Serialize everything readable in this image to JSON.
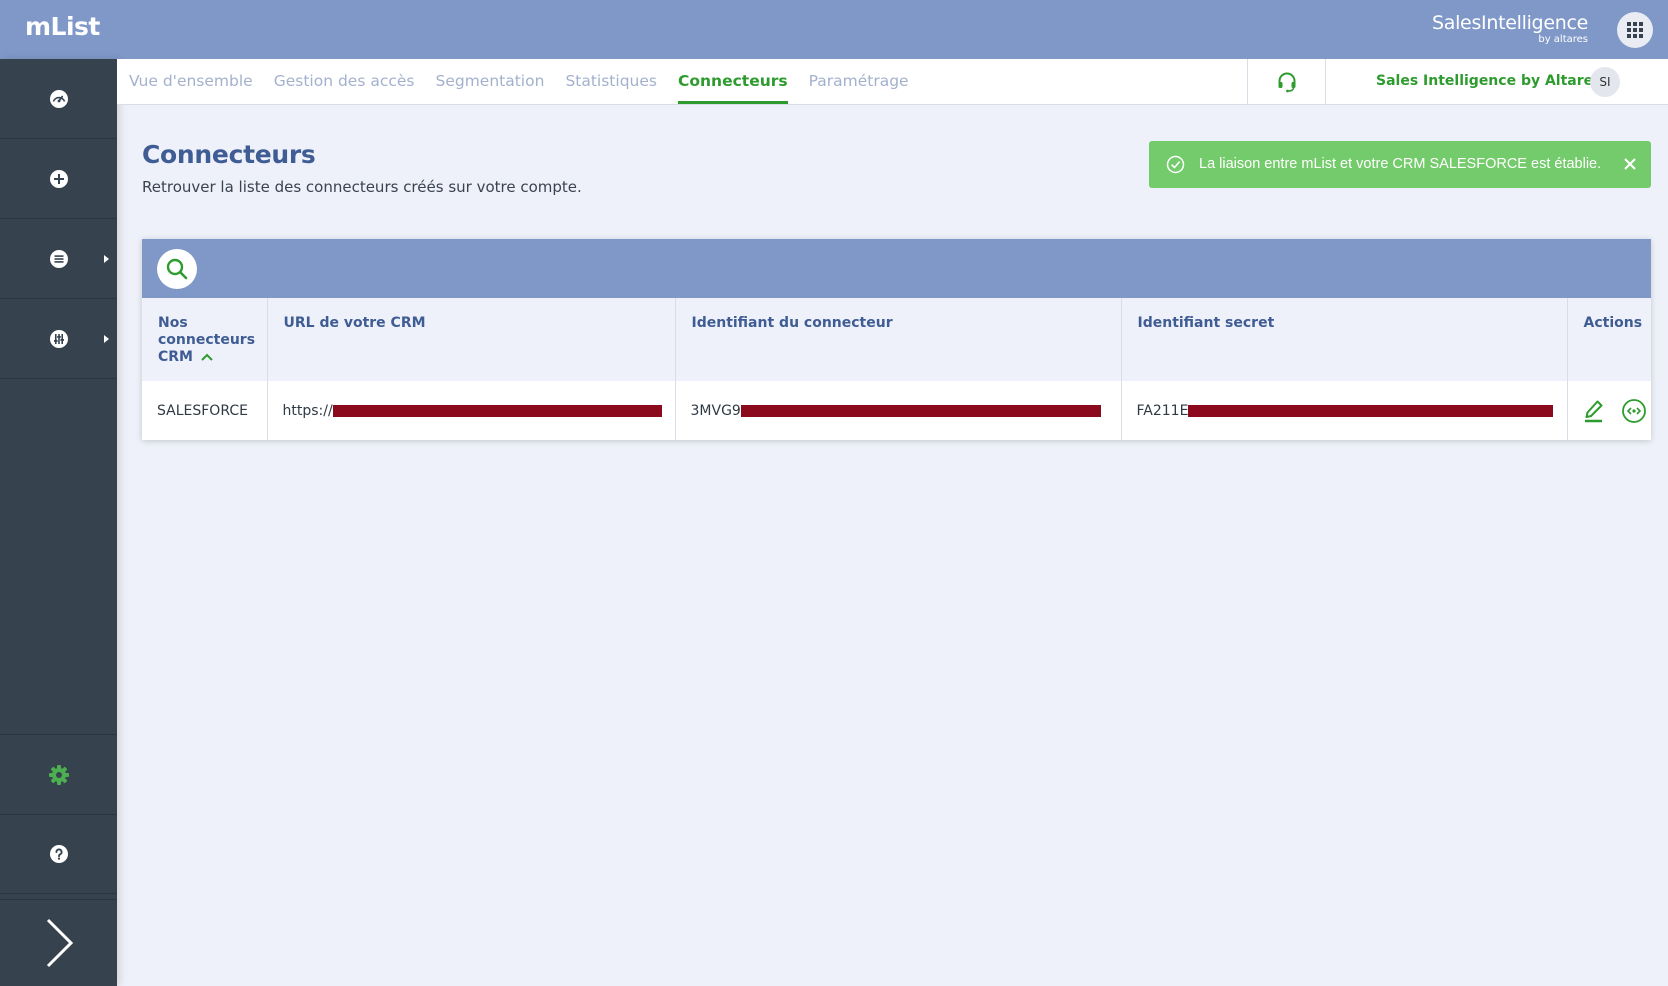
{
  "app": {
    "title": "mList"
  },
  "brand": {
    "name": "SalesIntelligence",
    "sub": "by altares"
  },
  "nav": {
    "tabs": [
      {
        "label": "Vue d'ensemble"
      },
      {
        "label": "Gestion des accès"
      },
      {
        "label": "Segmentation"
      },
      {
        "label": "Statistiques"
      },
      {
        "label": "Connecteurs",
        "active": true
      },
      {
        "label": "Paramétrage"
      }
    ],
    "account_name": "Sales Intelligence by Altares",
    "avatar_initials": "SI"
  },
  "sidebar": {
    "items": [
      {
        "icon": "dashboard-icon"
      },
      {
        "icon": "plus-circle-icon"
      },
      {
        "icon": "list-icon",
        "has_submenu": true
      },
      {
        "icon": "sliders-icon",
        "has_submenu": true
      },
      {
        "icon": "gear-icon",
        "active": true
      },
      {
        "icon": "help-icon"
      },
      {
        "icon": "chevron-right-icon"
      }
    ]
  },
  "page": {
    "title": "Connecteurs",
    "subtitle": "Retrouver la liste des connecteurs créés sur votre compte."
  },
  "toast": {
    "message": "La liaison entre mList et votre CRM SALESFORCE est établie.",
    "type": "success"
  },
  "table": {
    "columns": [
      {
        "label": "Nos connecteurs CRM",
        "sorted": "asc"
      },
      {
        "label": "URL de votre CRM"
      },
      {
        "label": "Identifiant du connecteur"
      },
      {
        "label": "Identifiant secret"
      },
      {
        "label": "Actions"
      }
    ],
    "rows": [
      {
        "crm": "SALESFORCE",
        "url_prefix": "https://",
        "connector_id_prefix": "3MVG9",
        "secret_prefix": "FA211E"
      }
    ]
  },
  "colors": {
    "header": "#7f98c8",
    "sidebar": "#36434f",
    "accent_green": "#2e9b2e",
    "toast_green": "#74cb6b",
    "title_blue": "#3f5d94",
    "redaction": "#8b0a1e"
  }
}
